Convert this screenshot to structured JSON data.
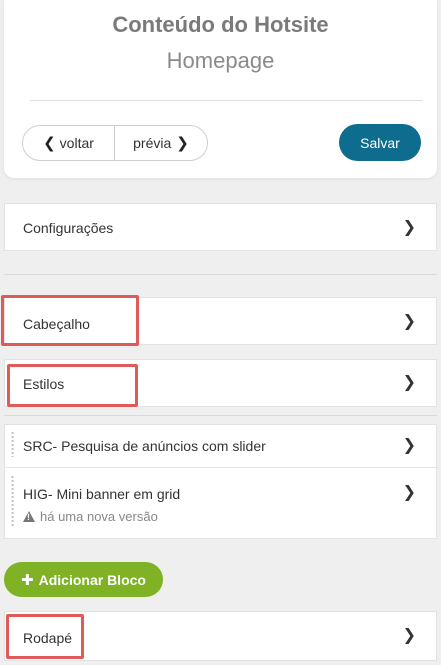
{
  "header": {
    "title": "Conteúdo do Hotsite",
    "subtitle": "Homepage",
    "back_label": "voltar",
    "preview_label": "prévia",
    "save_label": "Salvar"
  },
  "rows": {
    "config": "Configurações",
    "header_block": "Cabeçalho",
    "styles": "Estilos",
    "block1": "SRC- Pesquisa de anúncios com slider",
    "block2": "HIG- Mini banner em grid",
    "block2_warning": "há uma nova versão",
    "footer": "Rodapé"
  },
  "add_block_label": "Adicionar Bloco",
  "icons": {
    "chevron_left": "chevron-left-icon",
    "chevron_right": "chevron-right-icon",
    "warning": "warning-icon",
    "plus": "plus-icon"
  },
  "colors": {
    "save_button": "#0e6d8e",
    "add_button": "#7fb224",
    "highlight": "#e05a5a"
  }
}
